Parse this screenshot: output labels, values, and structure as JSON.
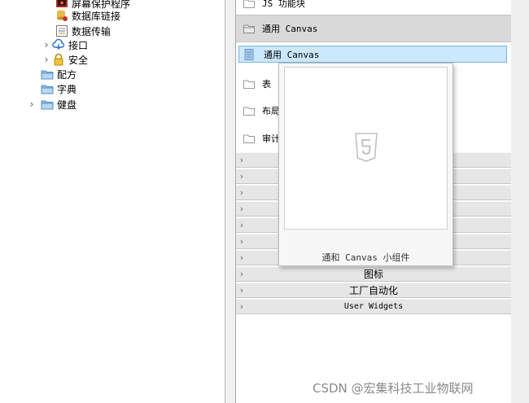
{
  "tree": {
    "items": [
      {
        "label": "屏幕保护程序",
        "icon": "screensaver-icon",
        "chevron": false
      },
      {
        "label": "数据库链接",
        "icon": "database-link-icon",
        "chevron": false
      },
      {
        "label": "数据传输",
        "icon": "data-transfer-icon",
        "chevron": false
      },
      {
        "label": "接口",
        "icon": "interface-cloud-icon",
        "chevron": true
      },
      {
        "label": "安全",
        "icon": "lock-icon",
        "chevron": true
      },
      {
        "label": "配方",
        "icon": "folder-icon",
        "chevron": false
      },
      {
        "label": "字典",
        "icon": "folder-icon",
        "chevron": false
      },
      {
        "label": "健盘",
        "icon": "folder-icon",
        "chevron": true
      }
    ]
  },
  "palette": {
    "top_item": "JS 功能块",
    "group_header": "通用 Canvas",
    "selected_item": "通用 Canvas",
    "items": [
      "表",
      "布局",
      "审计"
    ],
    "categories": [
      "",
      "",
      "",
      "",
      "",
      "",
      "",
      "图标",
      "工厂自动化",
      "User Widgets"
    ]
  },
  "popup": {
    "caption": "通和 Canvas 小组件",
    "icon": "html5-icon"
  },
  "watermark": "CSDN @宏集科技工业物联网",
  "colors": {
    "selection_bg": "#cce8ff",
    "selection_border": "#7ab4e6",
    "category_bg": "#e6e6e6",
    "group_header_bg": "#d9d9d9"
  }
}
